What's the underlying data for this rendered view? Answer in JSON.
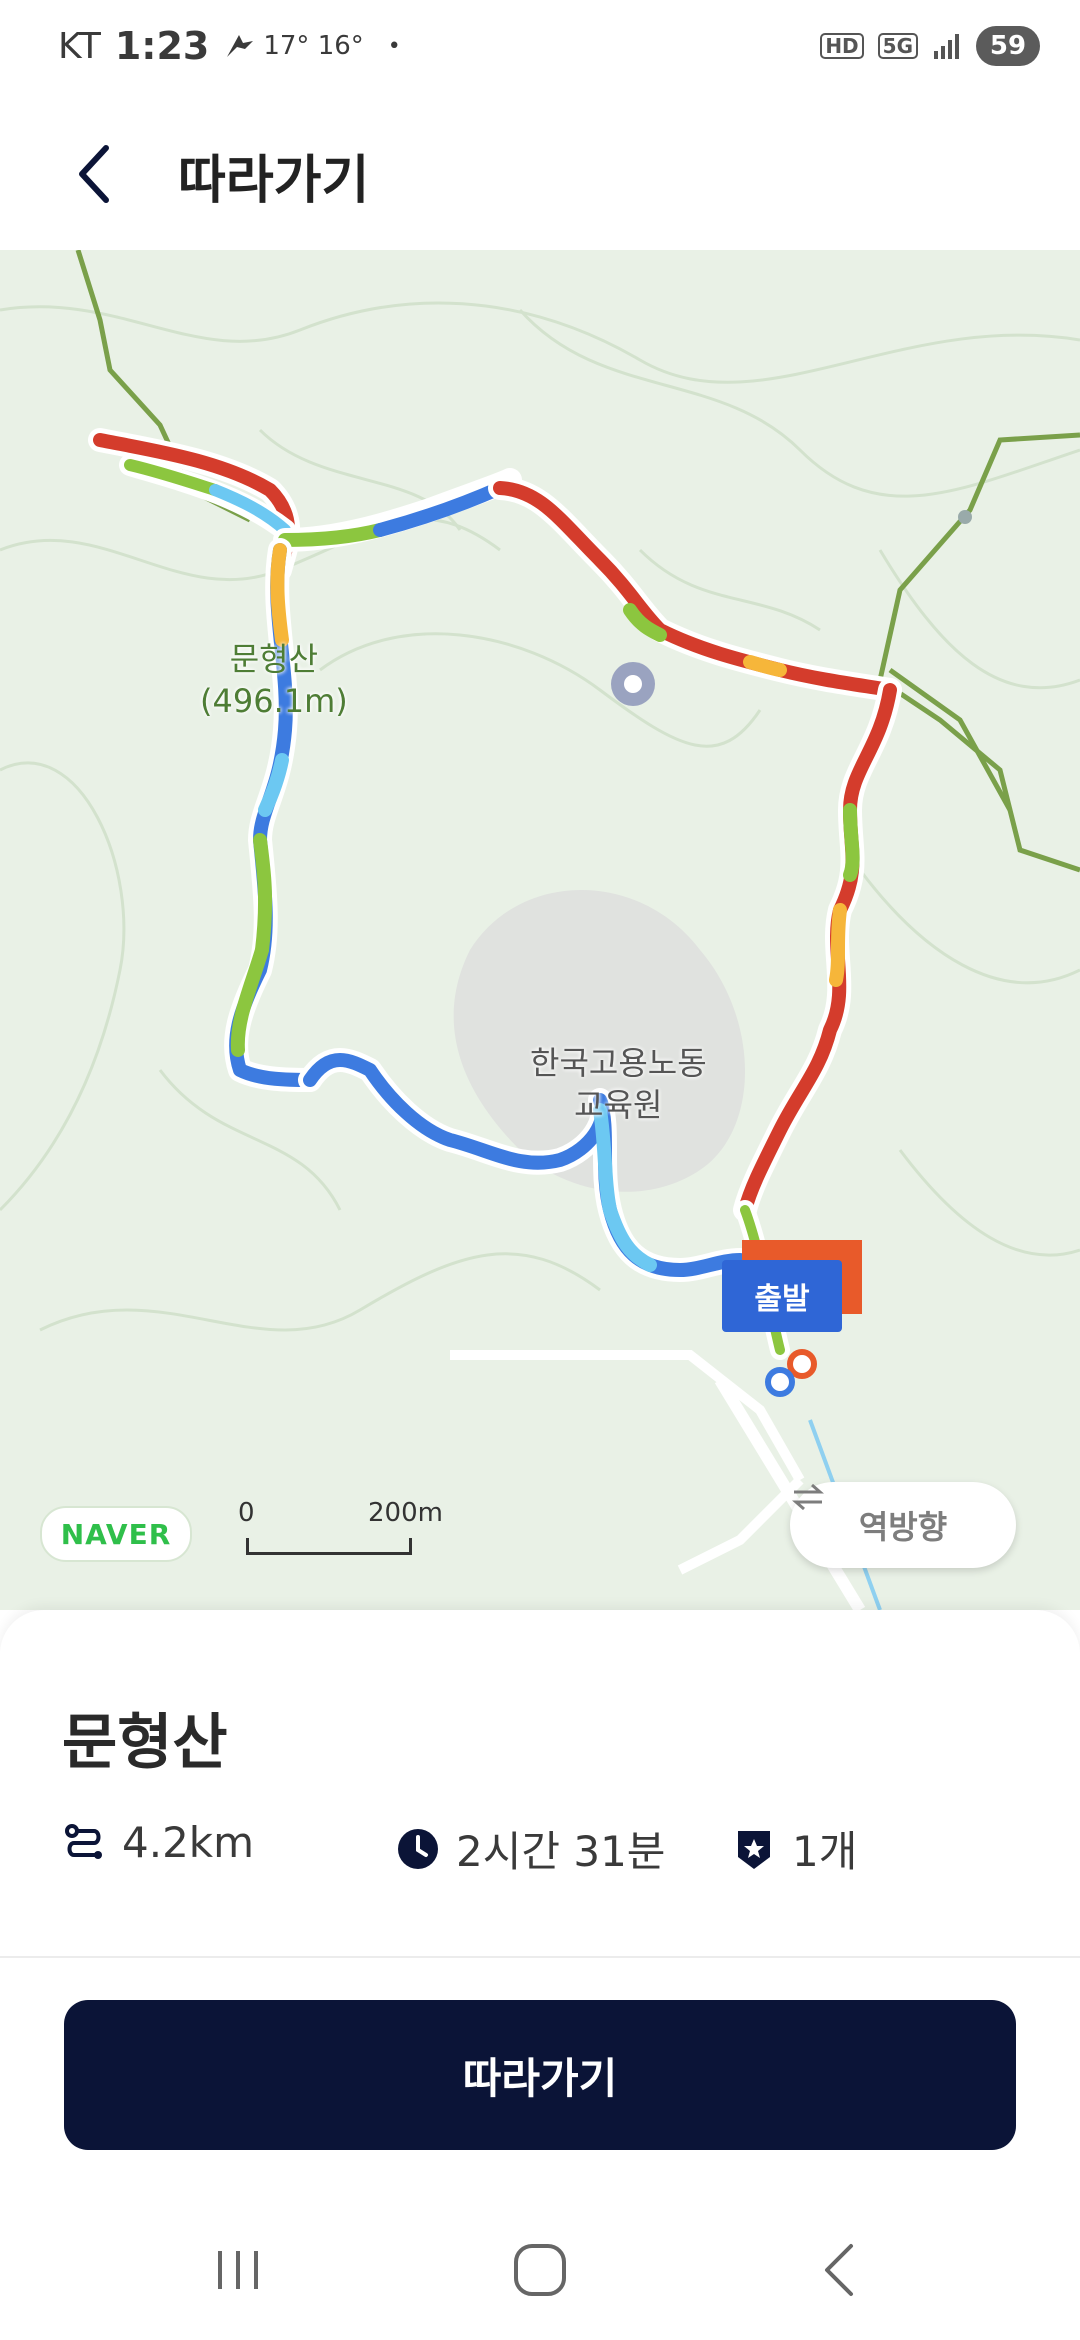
{
  "status_bar": {
    "carrier": "KT",
    "time": "1:23",
    "weather": "17° 16°",
    "dot": "•",
    "hd": "HD",
    "network": "5G",
    "battery": "59"
  },
  "header": {
    "title": "따라가기",
    "back_icon": "chevron-left-icon"
  },
  "map": {
    "peak_label_line1": "문형산",
    "peak_label_line2": "(496.1m)",
    "institution_label_line1": "한국고용노동",
    "institution_label_line2": "교육원",
    "start_tag": "출발",
    "provider": "NAVER",
    "scale_start": "0",
    "scale_end": "200m",
    "reverse_button": "역방향",
    "reverse_icon": "swap-arrows-icon",
    "route_colors": {
      "blue": "#3d7be0",
      "light_blue": "#6cc8f2",
      "green": "#8cc63f",
      "yellow": "#f6b63a",
      "red": "#d43c2c",
      "trail": "#7aa04a"
    }
  },
  "course": {
    "name": "문형산",
    "distance": "4.2km",
    "distance_icon": "route-icon",
    "duration": "2시간 31분",
    "duration_icon": "clock-icon",
    "badges": "1개",
    "badges_icon": "star-shield-icon"
  },
  "actions": {
    "follow_button": "따라가기"
  },
  "nav": {
    "recent_icon": "recent-apps-icon",
    "home_icon": "home-icon",
    "back_icon": "back-icon"
  },
  "colors": {
    "primary_dark": "#0b1437",
    "accent_blue": "#2f66d6",
    "accent_orange": "#e85a2a"
  }
}
